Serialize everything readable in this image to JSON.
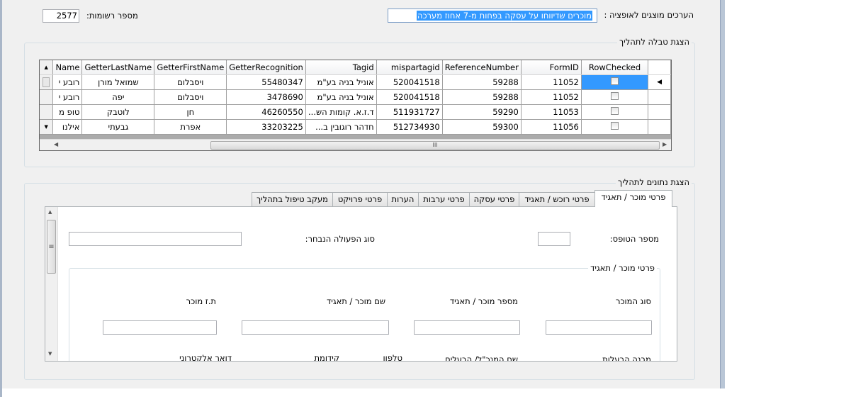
{
  "filter": {
    "label": "הערכים מוצגים לאופציה :",
    "value": "מוכרים שדיווחו על עסקה בפחות מ-7 אחוז מערכה",
    "records_label": "מספר רשומות:",
    "records_value": "2577"
  },
  "process_table": {
    "title": "הצגת טבלה לתהליך",
    "columns": [
      "RowChecked",
      "FormID",
      "ReferenceNumber",
      "mispartagid",
      "Tagid",
      "GetterRecognition",
      "GetterFirstName",
      "GetterLastName",
      "Name"
    ],
    "rows": [
      {
        "RowChecked": false,
        "FormID": "11052",
        "ReferenceNumber": "59288",
        "mispartagid": "520041518",
        "Tagid": "אוניל בניה בע\"מ",
        "GetterRecognition": "55480347",
        "GetterFirstName": "ויסבלום",
        "GetterLastName": "שמואל מורן",
        "Name": "רובע י"
      },
      {
        "RowChecked": false,
        "FormID": "11052",
        "ReferenceNumber": "59288",
        "mispartagid": "520041518",
        "Tagid": "אוניל בניה בע\"מ",
        "GetterRecognition": "3478690",
        "GetterFirstName": "ויסבלום",
        "GetterLastName": "יפה",
        "Name": "רובע י"
      },
      {
        "RowChecked": false,
        "FormID": "11053",
        "ReferenceNumber": "59290",
        "mispartagid": "511931727",
        "Tagid": "ד.ז.א. קומות הש...",
        "GetterRecognition": "46260550",
        "GetterFirstName": "חן",
        "GetterLastName": "לוטבק",
        "Name": "טופ מ"
      },
      {
        "RowChecked": false,
        "FormID": "11056",
        "ReferenceNumber": "59300",
        "mispartagid": "512734930",
        "Tagid": "חדהר רוגובין ב...",
        "GetterRecognition": "33203225",
        "GetterFirstName": "אפרת",
        "GetterLastName": "גבעתי",
        "Name": "אילנו"
      }
    ],
    "hscroll_grip": "III"
  },
  "details": {
    "title": "הצגת נתונים לתהליך",
    "tabs": [
      "פרטי מוכר / תאגיד",
      "פרטי רוכש / תאגיד",
      "פרטי עסקה",
      "פרטי ערבות",
      "הערות",
      "פרטי פרויקט",
      "מעקב טיפול בתהליך"
    ],
    "form_number_label": "מספר הטופס:",
    "form_number_value": "",
    "action_type_label": "סוג הפעולה הנבחר:",
    "action_type_value": "",
    "seller_group_title": "פרטי מוכר / תאגיד",
    "seller_fields": [
      {
        "label": "סוג המוכר",
        "value": ""
      },
      {
        "label": "מספר מוכר / תאגיד",
        "value": ""
      },
      {
        "label": "שם מוכר / תאגיד",
        "value": ""
      },
      {
        "label": "ת.ז מוכר",
        "value": ""
      }
    ],
    "partial_labels": [
      "מבנה הבעלות",
      "שם המנכ\"ל/ הבעלים",
      "טלפון",
      "קידומת",
      "דואר אלקטרוני"
    ],
    "vscroll_grip": "≡"
  },
  "colors": {
    "selected_cell": "#3399ff",
    "filter_selection": "#3399ff",
    "form_bg": "#f0f0f0",
    "grid_bg": "#ababab"
  }
}
